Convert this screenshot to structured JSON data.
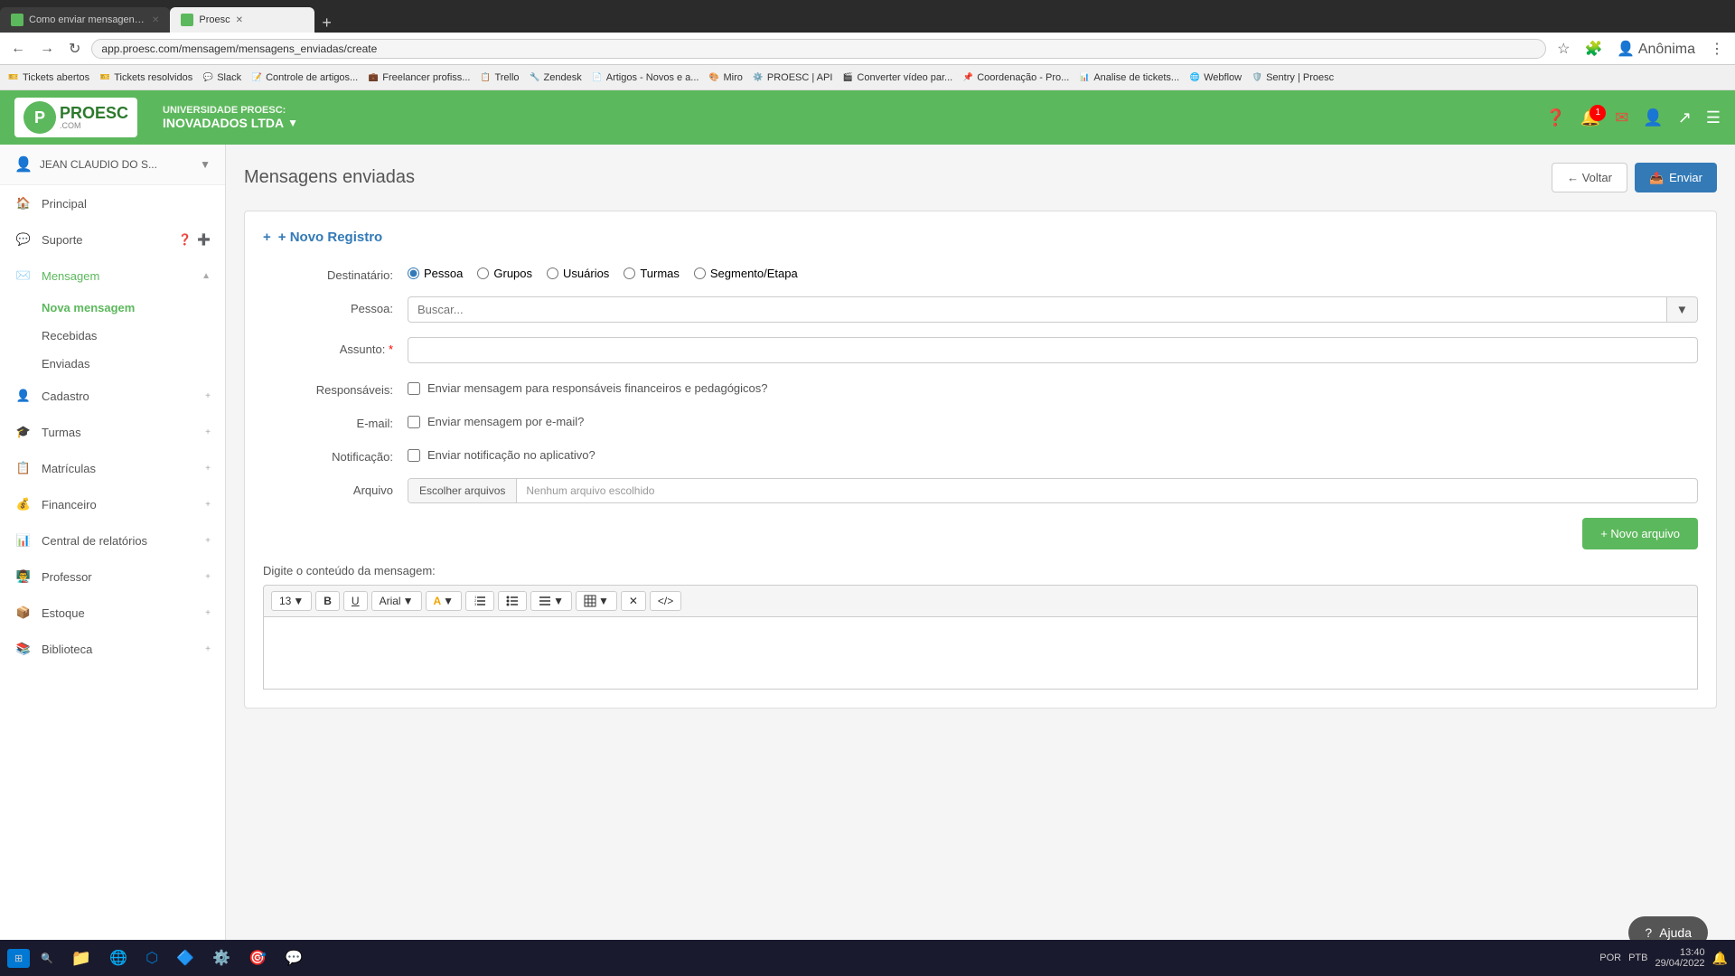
{
  "browser": {
    "tabs": [
      {
        "label": "Como enviar mensagens pelo P...",
        "active": false
      },
      {
        "label": "Proesc",
        "active": true
      }
    ],
    "url": "app.proesc.com/mensagem/mensagens_enviadas/create",
    "bookmarks": [
      {
        "label": "Tickets abertos",
        "color": "#e74c3c"
      },
      {
        "label": "Tickets resolvidos",
        "color": "#e74c3c"
      },
      {
        "label": "Slack",
        "color": "#4a154b"
      },
      {
        "label": "Controle de artigos...",
        "color": "#2ecc71"
      },
      {
        "label": "Freelancer profiss...",
        "color": "#f39c12"
      },
      {
        "label": "Trello",
        "color": "#0079bf"
      },
      {
        "label": "Zendesk",
        "color": "#03363d"
      },
      {
        "label": "Artigos - Novos e a...",
        "color": "#555"
      },
      {
        "label": "Miro",
        "color": "#ff0"
      },
      {
        "label": "PROESC | API",
        "color": "#5cb85c"
      },
      {
        "label": "Converter vídeo par...",
        "color": "#999"
      },
      {
        "label": "Coordenação - Pro...",
        "color": "#555"
      },
      {
        "label": "Analise de tickets...",
        "color": "#555"
      },
      {
        "label": "Webflow",
        "color": "#4353ff"
      },
      {
        "label": "Sentry | Proesc",
        "color": "#362d59"
      }
    ]
  },
  "header": {
    "university_label": "UNIVERSIDADE PROESC:",
    "institution_name": "INOVADADOS LTDA",
    "notification_count": "1"
  },
  "sidebar": {
    "user_name": "JEAN CLAUDIO DO S...",
    "items": [
      {
        "id": "principal",
        "label": "Principal",
        "icon": "🏠",
        "has_sub": false
      },
      {
        "id": "suporte",
        "label": "Suporte",
        "icon": "💬",
        "has_sub": false
      },
      {
        "id": "mensagem",
        "label": "Mensagem",
        "icon": "✉️",
        "has_sub": true,
        "expanded": true,
        "sub_items": [
          {
            "id": "nova-mensagem",
            "label": "Nova mensagem",
            "active": true
          },
          {
            "id": "recebidas",
            "label": "Recebidas",
            "active": false
          },
          {
            "id": "enviadas",
            "label": "Enviadas",
            "active": false
          }
        ]
      },
      {
        "id": "cadastro",
        "label": "Cadastro",
        "icon": "👤",
        "has_sub": true
      },
      {
        "id": "turmas",
        "label": "Turmas",
        "icon": "🎓",
        "has_sub": true
      },
      {
        "id": "matriculas",
        "label": "Matrículas",
        "icon": "📋",
        "has_sub": true
      },
      {
        "id": "financeiro",
        "label": "Financeiro",
        "icon": "💰",
        "has_sub": true
      },
      {
        "id": "relatorios",
        "label": "Central de relatórios",
        "icon": "📊",
        "has_sub": true
      },
      {
        "id": "professor",
        "label": "Professor",
        "icon": "👨‍🏫",
        "has_sub": true
      },
      {
        "id": "estoque",
        "label": "Estoque",
        "icon": "📦",
        "has_sub": true
      },
      {
        "id": "biblioteca",
        "label": "Biblioteca",
        "icon": "📚",
        "has_sub": true
      }
    ]
  },
  "page": {
    "title": "Mensagens enviadas",
    "back_btn": "← Voltar",
    "send_btn": "Enviar",
    "new_record_label": "+ Novo Registro",
    "form": {
      "destinatario_label": "Destinatário:",
      "radio_options": [
        "Pessoa",
        "Grupos",
        "Usuários",
        "Turmas",
        "Segmento/Etapa"
      ],
      "selected_radio": "Pessoa",
      "pessoa_label": "Pessoa:",
      "pessoa_placeholder": "Buscar...",
      "assunto_label": "Assunto:",
      "responsaveis_label": "Responsáveis:",
      "responsaveis_checkbox_label": "Enviar mensagem para responsáveis financeiros e pedagógicos?",
      "email_label": "E-mail:",
      "email_checkbox_label": "Enviar mensagem por e-mail?",
      "notificacao_label": "Notificação:",
      "notificacao_checkbox_label": "Enviar notificação no aplicativo?",
      "arquivo_label": "Arquivo",
      "file_choose_btn": "Escolher arquivos",
      "file_placeholder": "Nenhum arquivo escolhido",
      "new_arquivo_btn": "+ Novo arquivo",
      "content_label": "Digite o conteúdo da mensagem:",
      "toolbar": {
        "font_size": "13",
        "bold": "B",
        "underline": "U",
        "font": "Arial",
        "text_color": "A",
        "list_ordered": "☰",
        "list_unordered": "☱",
        "align": "≡",
        "table": "⊞",
        "clear": "✕",
        "html": "</>"
      }
    }
  },
  "help_btn": "Ajuda",
  "taskbar": {
    "time": "13:40",
    "date": "29/04/2022",
    "language": "POR",
    "layout": "PTB"
  }
}
